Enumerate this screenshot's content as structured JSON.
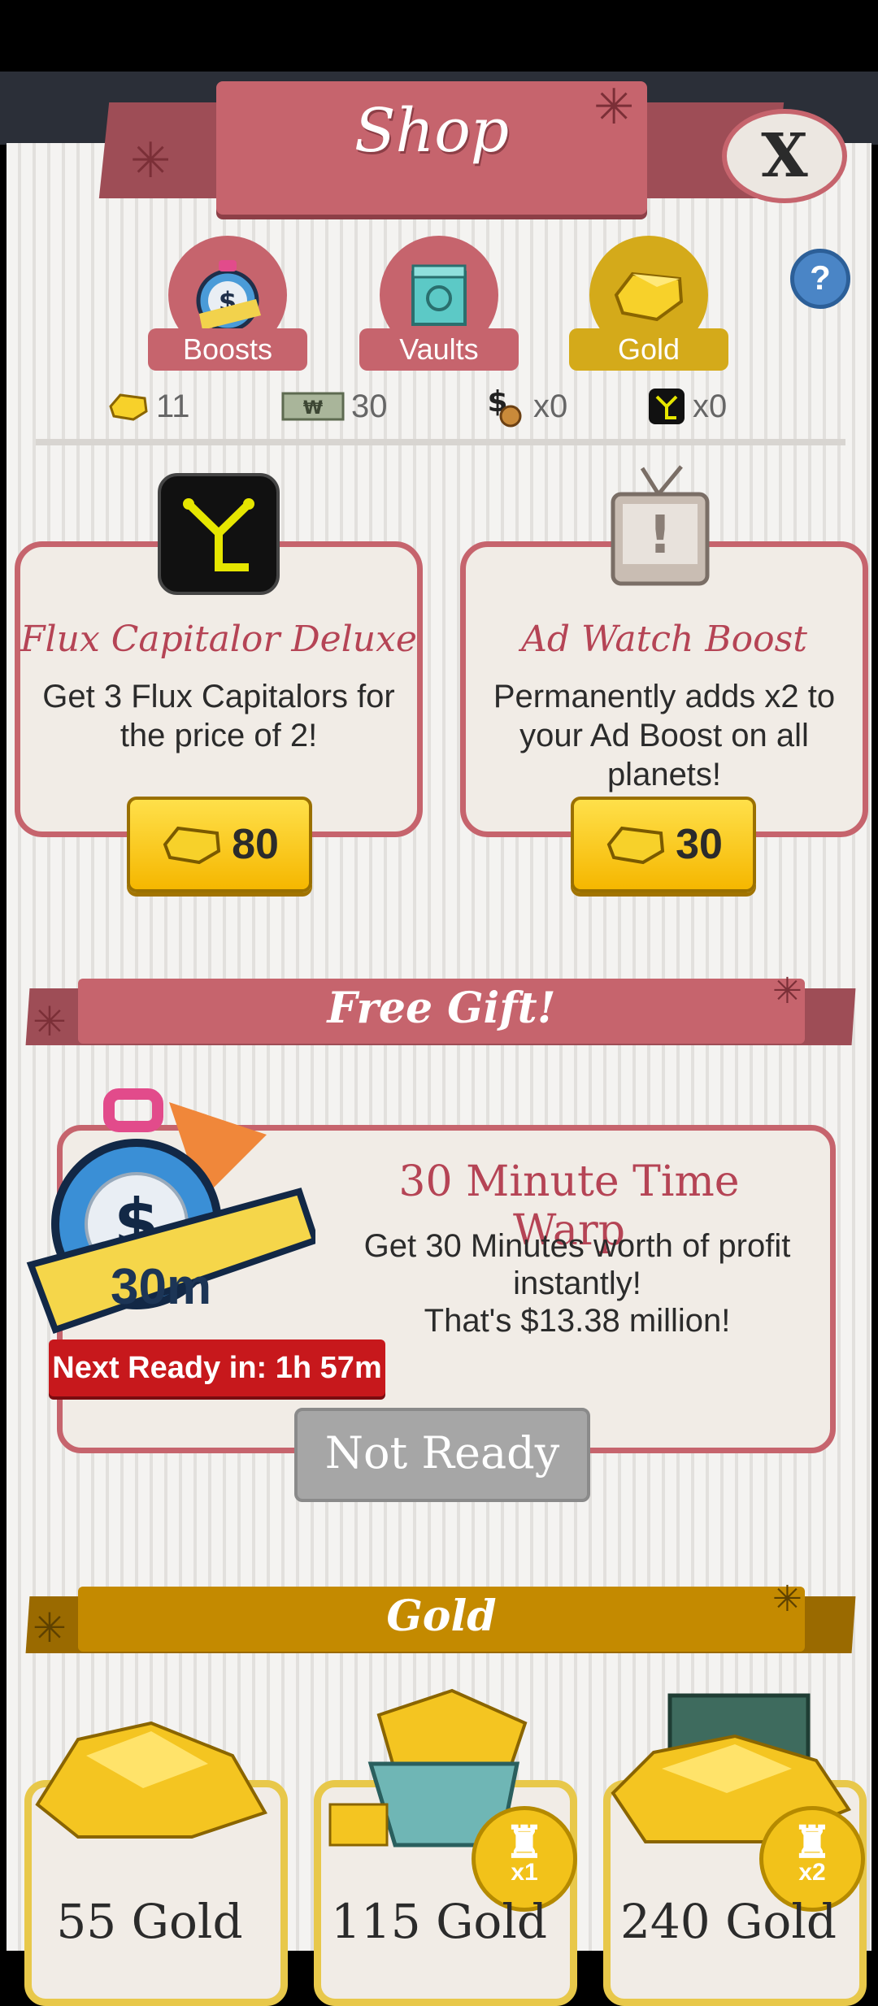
{
  "header": {
    "title": "Shop",
    "close_label": "X"
  },
  "tabs": [
    {
      "label": "Boosts",
      "icon": "stopwatch-icon",
      "active": false
    },
    {
      "label": "Vaults",
      "icon": "vault-icon",
      "active": false
    },
    {
      "label": "Gold",
      "icon": "gold-icon",
      "active": true
    }
  ],
  "help_label": "?",
  "currencies": [
    {
      "icon": "gold-icon",
      "value": "11"
    },
    {
      "icon": "megabucks-icon",
      "value": "30"
    },
    {
      "icon": "moneybag-icon",
      "value": "x0"
    },
    {
      "icon": "flux-capitalor-icon",
      "value": "x0"
    }
  ],
  "offers": [
    {
      "title": "Flux Capitalor Deluxe",
      "description": "Get 3 Flux Capitalors for the price of 2!",
      "price": "80"
    },
    {
      "title": "Ad Watch Boost",
      "description": "Permanently adds x2 to your Ad Boost on all planets!",
      "price": "30"
    }
  ],
  "free_gift": {
    "section_title": "Free Gift!",
    "title": "30 Minute Time Warp",
    "desc_line1": "Get 30 Minutes worth of profit instantly!",
    "desc_line2": "That's $13.38 million!",
    "timer_label": "30m",
    "next_ready": "Next Ready in: 1h 57m",
    "button_label": "Not Ready"
  },
  "gold_section": {
    "title": "Gold",
    "packs": [
      {
        "label": "55 Gold",
        "badge": ""
      },
      {
        "label": "115 Gold",
        "badge": "x1"
      },
      {
        "label": "240 Gold",
        "badge": "x2"
      }
    ]
  },
  "colors": {
    "accent": "#c6646d",
    "gold": "#c48a00",
    "panel": "#ebe9e6"
  }
}
